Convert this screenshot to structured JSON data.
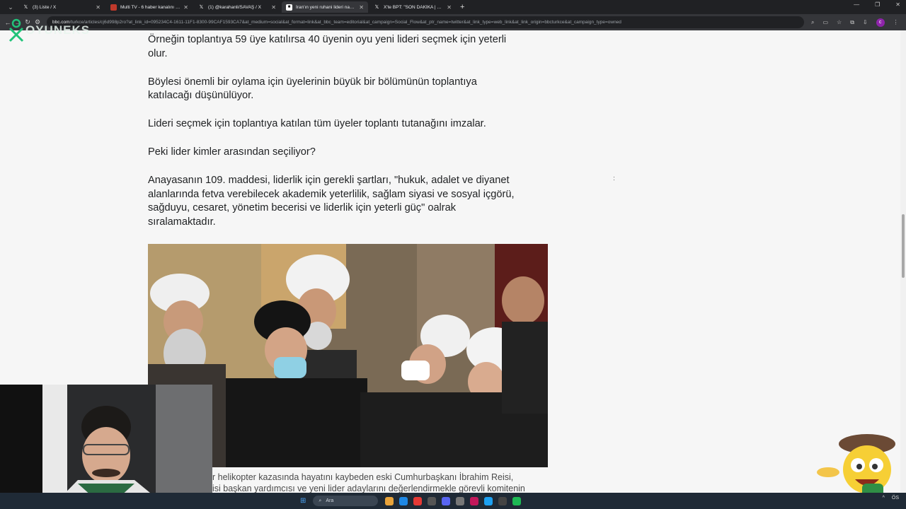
{
  "browser": {
    "tabs": [
      {
        "title": "(3) Liste / X",
        "icon": "x-logo-icon",
        "active": false
      },
      {
        "title": "Multi TV - 6 haber kanalını aynı",
        "icon": "tv-icon",
        "active": false
      },
      {
        "title": "(1) @karahanli/SAVAŞ / X",
        "icon": "x-logo-icon",
        "active": false
      },
      {
        "title": "İran'ın yeni ruhani lideri nasıl se",
        "icon": "bbc-icon",
        "active": true
      },
      {
        "title": "X'te BPT: \"SON DAKİKA | Kuvey",
        "icon": "x-logo-icon",
        "active": false
      }
    ],
    "url_domain": "bbc.com",
    "url_rest": "/turkce/articles/cj6d998p2ro?at_link_id=095234C4-1611-11F1-8300-99CAF1593CA7&at_medium=social&at_format=link&at_bbc_team=editorial&at_campaign=Social_Flow&at_ptr_name=twitter&at_link_type=web_link&at_link_origin=bbcturkce&at_campaign_type=owned",
    "profile_initial": "c"
  },
  "article": {
    "paragraphs": [
      "Örneğin toplantıya 59 üye katılırsa 40 üyenin oyu yeni lideri seçmek için yeterli olur.",
      "Böylesi önemli bir oylama için üyelerinin büyük bir bölümünün toplantıya katılacağı düşünülüyor.",
      "Lideri seçmek için toplantıya katılan tüm üyeler toplantı tutanağını imzalar.",
      "Peki lider kimler arasından seçiliyor?",
      "Anayasanın 109. maddesi, liderlik için gerekli şartları, \"hukuk, adalet ve diyanet alanlarında fetva verebilecek akademik yeterlilik, sağlam siyasi ve sosyal içgörü, sağduyu, cesaret, yönetim becerisi ve liderlik için yeterli güç\" oalrak sıralamaktadır."
    ],
    "caption_line1": "r helikopter kazasında hayatını kaybeden eski Cumhurbaşkanı İbrahim Reisi,",
    "caption_line2": "isi başkan yardımcısı ve yeni lider adaylarını değerlendirmekle görevli komitenin"
  },
  "overlay": {
    "logo_text": "OYUNEKS"
  },
  "taskbar": {
    "search_placeholder": "Ara",
    "tray_text": "ÖS"
  }
}
